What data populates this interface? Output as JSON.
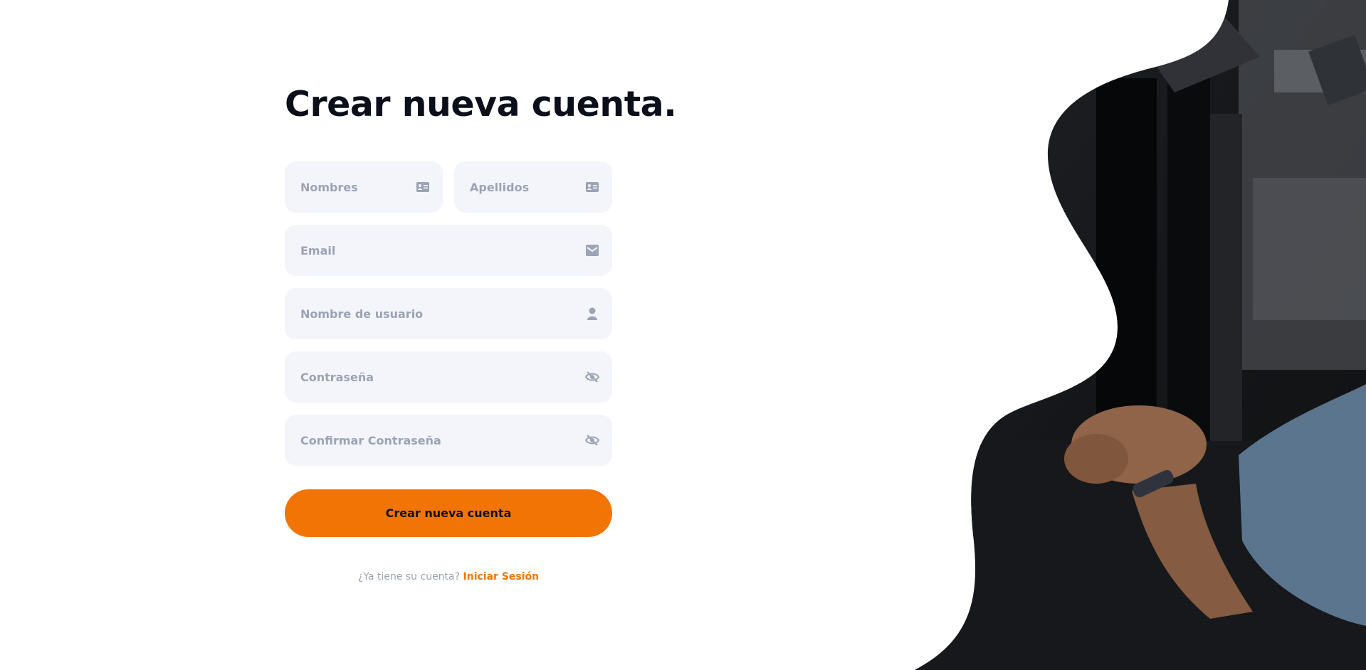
{
  "page": {
    "title": "Crear nueva cuenta.",
    "accent_color": "#f27405",
    "field_background": "#f4f5fa"
  },
  "form": {
    "first_name": {
      "placeholder": "Nombres",
      "icon": "id-card-icon"
    },
    "last_name": {
      "placeholder": "Apellidos",
      "icon": "id-card-icon"
    },
    "email": {
      "placeholder": "Email",
      "icon": "envelope-icon"
    },
    "username": {
      "placeholder": "Nombre de usuario",
      "icon": "user-icon"
    },
    "password": {
      "placeholder": "Contraseña",
      "icon": "eye-slash-icon"
    },
    "confirm_password": {
      "placeholder": "Confirmar Contraseña",
      "icon": "eye-slash-icon"
    },
    "submit_label": "Crear nueva cuenta"
  },
  "footer": {
    "prompt": "¿Ya tiene su cuenta?",
    "login_link": "Iniciar Sesión"
  },
  "hero": {
    "image": "gym-workout-photo"
  }
}
